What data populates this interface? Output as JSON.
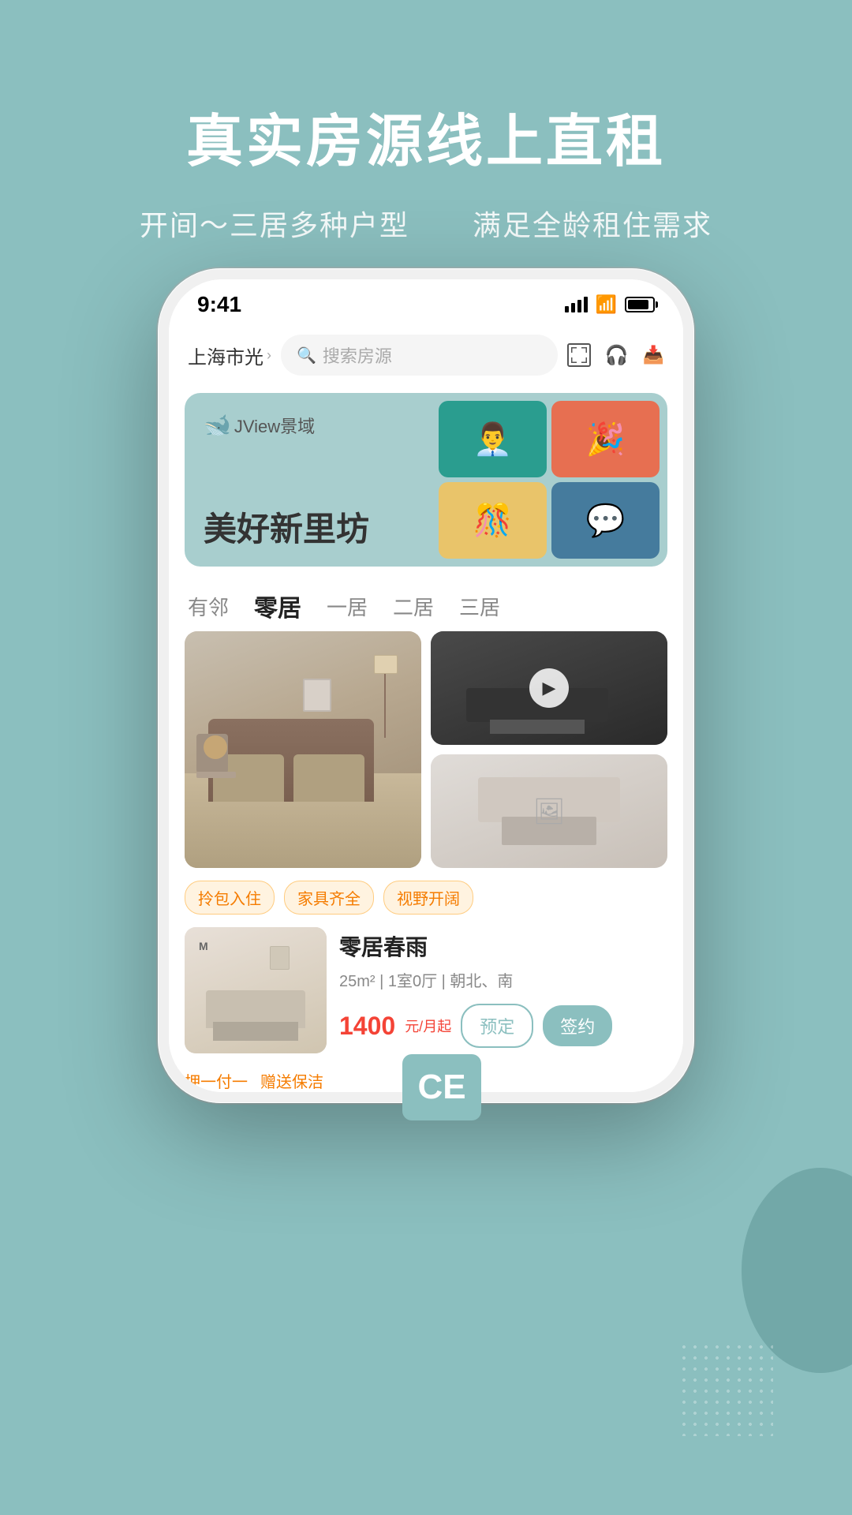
{
  "background": {
    "color": "#8bbfbf"
  },
  "header": {
    "main_title": "真实房源线上直租",
    "sub_left": "开间～三居多种户型",
    "sub_right": "满足全龄租住需求"
  },
  "phone": {
    "status_bar": {
      "time": "9:41"
    },
    "search_bar": {
      "location": "上海市光",
      "placeholder": "搜索房源"
    },
    "banner": {
      "brand": "JView景域",
      "title": "美好新里坊"
    },
    "tabs": [
      {
        "label": "有邻",
        "active": false
      },
      {
        "label": "零居",
        "active": true
      },
      {
        "label": "一居",
        "active": false
      },
      {
        "label": "二居",
        "active": false
      },
      {
        "label": "三居",
        "active": false
      }
    ],
    "tags": [
      {
        "label": "拎包入住"
      },
      {
        "label": "家具齐全"
      },
      {
        "label": "视野开阔"
      }
    ],
    "listing": {
      "title": "零居春雨",
      "meta": "25m² | 1室0厅 | 朝北、南",
      "price": "1400",
      "price_unit": "元/月起",
      "btn_reserve": "预定",
      "btn_sign": "签约",
      "footer_left": "押一付一",
      "footer_right": "赠送保洁"
    }
  },
  "ce_badge": "CE"
}
